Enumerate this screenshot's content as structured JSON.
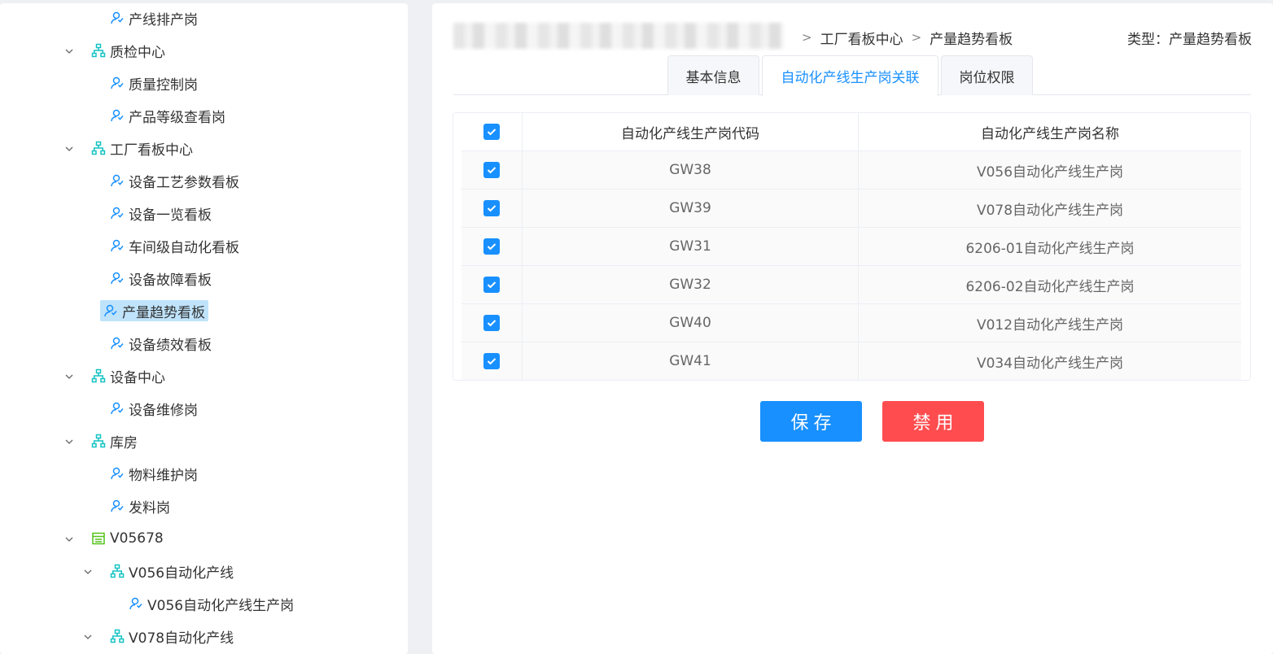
{
  "tree": {
    "items": [
      {
        "label": "产线排产岗",
        "icon": "user-icon",
        "level": 1
      },
      {
        "label": "质检中心",
        "icon": "org-chart-icon",
        "level": 0,
        "expanded": true
      },
      {
        "label": "质量控制岗",
        "icon": "user-icon",
        "level": 1
      },
      {
        "label": "产品等级查看岗",
        "icon": "user-icon",
        "level": 1
      },
      {
        "label": "工厂看板中心",
        "icon": "org-chart-icon",
        "level": 0,
        "expanded": true
      },
      {
        "label": "设备工艺参数看板",
        "icon": "user-icon",
        "level": 1
      },
      {
        "label": "设备一览看板",
        "icon": "user-icon",
        "level": 1
      },
      {
        "label": "车间级自动化看板",
        "icon": "user-icon",
        "level": 1
      },
      {
        "label": "设备故障看板",
        "icon": "user-icon",
        "level": 1
      },
      {
        "label": "产量趋势看板",
        "icon": "user-icon",
        "level": 1,
        "selected": true
      },
      {
        "label": "设备绩效看板",
        "icon": "user-icon",
        "level": 1
      },
      {
        "label": "设备中心",
        "icon": "org-chart-icon",
        "level": 0,
        "expanded": true
      },
      {
        "label": "设备维修岗",
        "icon": "user-icon",
        "level": 1
      },
      {
        "label": "库房",
        "icon": "org-chart-icon",
        "level": 0,
        "expanded": true
      },
      {
        "label": "物料维护岗",
        "icon": "user-icon",
        "level": 1
      },
      {
        "label": "发料岗",
        "icon": "user-icon",
        "level": 1
      },
      {
        "label": "V05678",
        "icon": "factory-icon",
        "level": 0,
        "expanded": true
      },
      {
        "label": "V056自动化产线",
        "icon": "org-chart-icon",
        "level": 1,
        "expanded": true
      },
      {
        "label": "V056自动化产线生产岗",
        "icon": "user-icon",
        "level": 2
      },
      {
        "label": "V078自动化产线",
        "icon": "org-chart-icon",
        "level": 1,
        "expanded": true
      }
    ]
  },
  "breadcrumb": {
    "items": [
      "工厂看板中心",
      "产量趋势看板"
    ],
    "separator": ">"
  },
  "type_info": "类型：产量趋势看板",
  "tabs": [
    {
      "label": "基本信息",
      "active": false
    },
    {
      "label": "自动化产线生产岗关联",
      "active": true
    },
    {
      "label": "岗位权限",
      "active": false
    }
  ],
  "table": {
    "columns": [
      "自动化产线生产岗代码",
      "自动化产线生产岗名称"
    ],
    "header_checked": true,
    "rows": [
      {
        "code": "GW38",
        "name": "V056自动化产线生产岗",
        "checked": true
      },
      {
        "code": "GW39",
        "name": "V078自动化产线生产岗",
        "checked": true
      },
      {
        "code": "GW31",
        "name": "6206-01自动化产线生产岗",
        "checked": true
      },
      {
        "code": "GW32",
        "name": "6206-02自动化产线生产岗",
        "checked": true
      },
      {
        "code": "GW40",
        "name": "V012自动化产线生产岗",
        "checked": true
      },
      {
        "code": "GW41",
        "name": "V034自动化产线生产岗",
        "checked": true
      }
    ]
  },
  "buttons": {
    "save_label": "保存",
    "disable_label": "禁用"
  },
  "colors": {
    "primary": "#1890ff",
    "danger": "#ff4d4f",
    "org_icon": "#13c2c2",
    "factory_icon": "#52c41a",
    "selected_bg": "#bfe3fb"
  }
}
